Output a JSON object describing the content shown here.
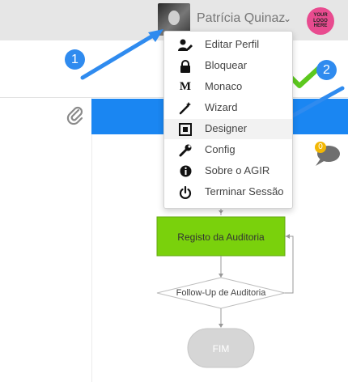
{
  "header": {
    "user_name": "Patrícia Quinaz",
    "logo_text": "YOUR LOGO HERE"
  },
  "menu": {
    "items": [
      {
        "label": "Editar Perfil",
        "icon": "user-edit-icon"
      },
      {
        "label": "Bloquear",
        "icon": "lock-icon"
      },
      {
        "label": "Monaco",
        "icon": "monaco-m-icon"
      },
      {
        "label": "Wizard",
        "icon": "magic-wand-icon"
      },
      {
        "label": "Designer",
        "icon": "designer-icon"
      },
      {
        "label": "Config",
        "icon": "wrench-icon"
      },
      {
        "label": "Sobre o AGIR",
        "icon": "info-icon"
      },
      {
        "label": "Terminar Sessão",
        "icon": "power-icon"
      }
    ],
    "highlighted": "Designer"
  },
  "annotations": {
    "step1": "1",
    "step2": "2"
  },
  "notifications": {
    "count": "0"
  },
  "flowchart": {
    "process_label": "Registo da Auditoria",
    "decision_label": "Follow-Up de Auditoria",
    "end_label": "FIM"
  },
  "colors": {
    "accent_blue": "#1a86f2",
    "step_blue": "#2f8bef",
    "process_green": "#7ad10c",
    "check_green": "#5cc81e",
    "badge_yellow": "#f2b705"
  }
}
